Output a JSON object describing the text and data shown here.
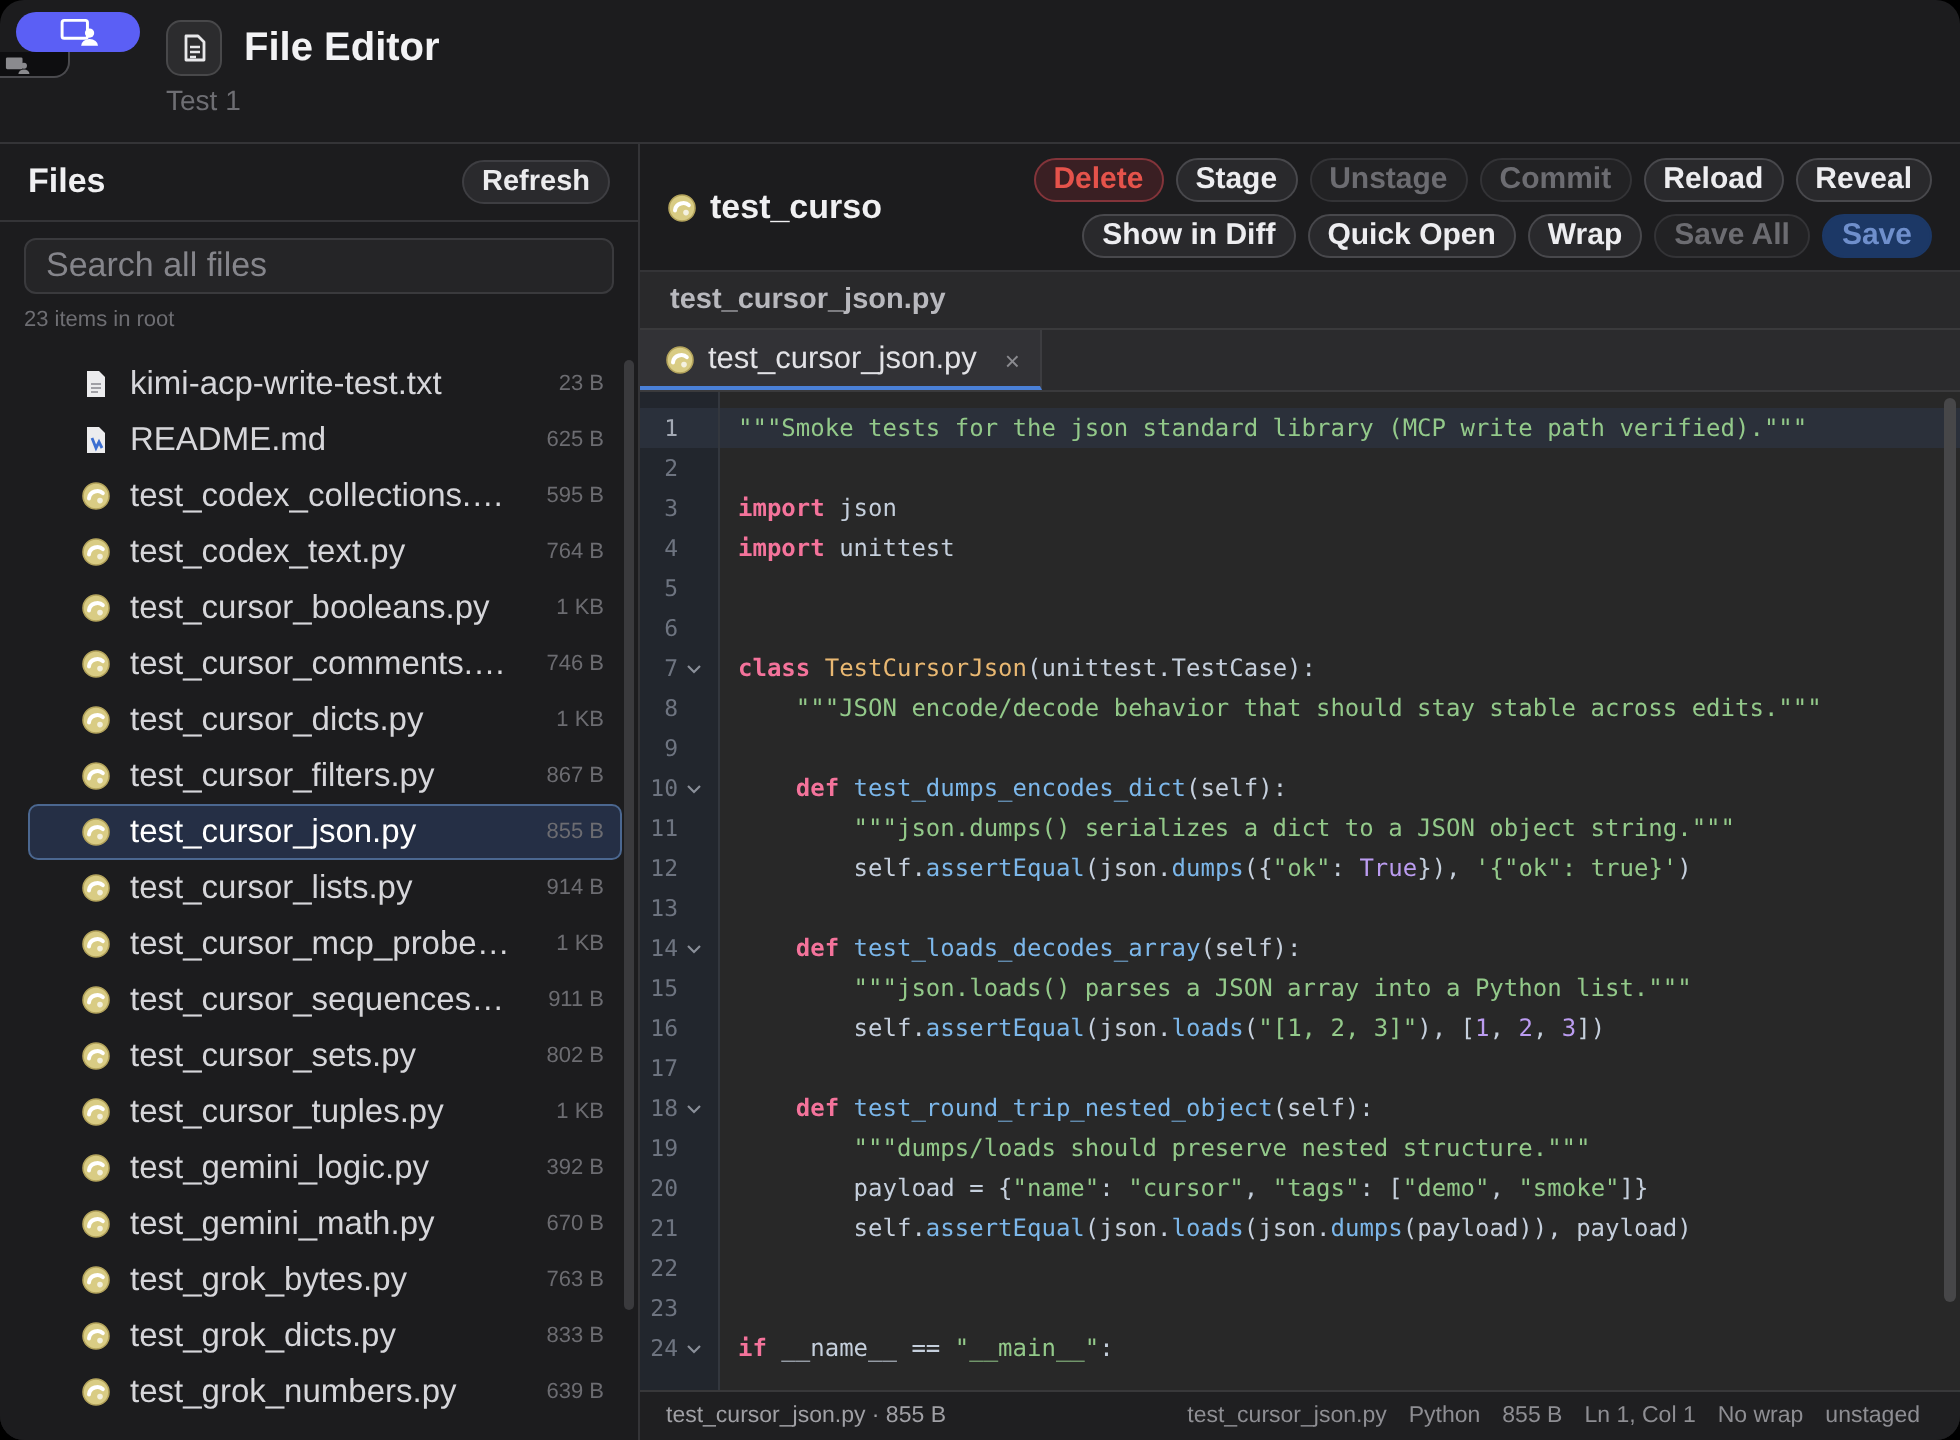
{
  "header": {
    "title": "File Editor",
    "subtitle": "Test 1"
  },
  "sidebar": {
    "title": "Files",
    "refresh_button": "Refresh",
    "search": {
      "placeholder": "Search all files"
    },
    "summary": "23 items in root",
    "files": [
      {
        "name": "kimi-acp-write-test.txt",
        "size": "23 B",
        "kind": "text",
        "selected": false
      },
      {
        "name": "README.md",
        "size": "625 B",
        "kind": "markdown",
        "selected": false
      },
      {
        "name": "test_codex_collections.…",
        "size": "595 B",
        "kind": "python",
        "selected": false
      },
      {
        "name": "test_codex_text.py",
        "size": "764 B",
        "kind": "python",
        "selected": false
      },
      {
        "name": "test_cursor_booleans.py",
        "size": "1 KB",
        "kind": "python",
        "selected": false
      },
      {
        "name": "test_cursor_comments.…",
        "size": "746 B",
        "kind": "python",
        "selected": false
      },
      {
        "name": "test_cursor_dicts.py",
        "size": "1 KB",
        "kind": "python",
        "selected": false
      },
      {
        "name": "test_cursor_filters.py",
        "size": "867 B",
        "kind": "python",
        "selected": false
      },
      {
        "name": "test_cursor_json.py",
        "size": "855 B",
        "kind": "python",
        "selected": true
      },
      {
        "name": "test_cursor_lists.py",
        "size": "914 B",
        "kind": "python",
        "selected": false
      },
      {
        "name": "test_cursor_mcp_probe…",
        "size": "1 KB",
        "kind": "python",
        "selected": false
      },
      {
        "name": "test_cursor_sequences…",
        "size": "911 B",
        "kind": "python",
        "selected": false
      },
      {
        "name": "test_cursor_sets.py",
        "size": "802 B",
        "kind": "python",
        "selected": false
      },
      {
        "name": "test_cursor_tuples.py",
        "size": "1 KB",
        "kind": "python",
        "selected": false
      },
      {
        "name": "test_gemini_logic.py",
        "size": "392 B",
        "kind": "python",
        "selected": false
      },
      {
        "name": "test_gemini_math.py",
        "size": "670 B",
        "kind": "python",
        "selected": false
      },
      {
        "name": "test_grok_bytes.py",
        "size": "763 B",
        "kind": "python",
        "selected": false
      },
      {
        "name": "test_grok_dicts.py",
        "size": "833 B",
        "kind": "python",
        "selected": false
      },
      {
        "name": "test_grok_numbers.py",
        "size": "639 B",
        "kind": "python",
        "selected": false
      }
    ]
  },
  "editor": {
    "file_title": "test_curso",
    "toolbar_rows": [
      {
        "buttons": [
          {
            "label": "Delete",
            "kind": "danger",
            "disabled": false
          },
          {
            "label": "Stage",
            "kind": "normal",
            "disabled": false
          },
          {
            "label": "Unstage",
            "kind": "normal",
            "disabled": true
          },
          {
            "label": "Commit",
            "kind": "normal",
            "disabled": true
          },
          {
            "label": "Reload",
            "kind": "normal",
            "disabled": false
          },
          {
            "label": "Reveal",
            "kind": "normal",
            "disabled": false
          }
        ]
      },
      {
        "buttons": [
          {
            "label": "Show in Diff",
            "kind": "normal",
            "disabled": false
          },
          {
            "label": "Quick Open",
            "kind": "normal",
            "disabled": false
          },
          {
            "label": "Wrap",
            "kind": "normal",
            "disabled": false
          },
          {
            "label": "Save All",
            "kind": "normal",
            "disabled": true
          },
          {
            "label": "Save",
            "kind": "primary",
            "disabled": true
          }
        ]
      }
    ],
    "breadcrumb": "test_cursor_json.py",
    "tabs": [
      {
        "label": "test_cursor_json.py",
        "close": "×",
        "selected": true
      }
    ],
    "lines": [
      {
        "n": "1",
        "current": true,
        "foldable": false,
        "tokens": [
          {
            "kind": "string",
            "text": "\"\"\"Smoke tests for the json standard library (MCP write path verified).\"\"\""
          }
        ]
      },
      {
        "n": "2",
        "current": false,
        "foldable": false
      },
      {
        "n": "3",
        "current": false,
        "foldable": false,
        "tokens": [
          {
            "kind": "keyword",
            "text": "import"
          },
          {
            "kind": "plain",
            "text": " json"
          }
        ]
      },
      {
        "n": "4",
        "current": false,
        "foldable": false,
        "tokens": [
          {
            "kind": "keyword",
            "text": "import"
          },
          {
            "kind": "plain",
            "text": " unittest"
          }
        ]
      },
      {
        "n": "5",
        "current": false,
        "foldable": false
      },
      {
        "n": "6",
        "current": false,
        "foldable": false
      },
      {
        "n": "7",
        "current": false,
        "foldable": true,
        "tokens": [
          {
            "kind": "keyword",
            "text": "class "
          },
          {
            "kind": "class",
            "text": "TestCursorJson"
          },
          {
            "kind": "plain",
            "text": "(unittest.TestCase):"
          }
        ]
      },
      {
        "n": "8",
        "current": false,
        "foldable": false,
        "tokens": [
          {
            "kind": "string",
            "text": "    \"\"\"JSON encode/decode behavior that should stay stable across edits.\"\"\""
          }
        ]
      },
      {
        "n": "9",
        "current": false,
        "foldable": false
      },
      {
        "n": "10",
        "current": false,
        "foldable": true,
        "tokens": [
          {
            "kind": "keyword",
            "text": "    def "
          },
          {
            "kind": "function",
            "text": "test_dumps_encodes_dict"
          },
          {
            "kind": "plain",
            "text": "(self):"
          }
        ]
      },
      {
        "n": "11",
        "current": false,
        "foldable": false,
        "tokens": [
          {
            "kind": "string",
            "text": "        \"\"\"json.dumps() serializes a dict to a JSON object string.\"\"\""
          }
        ]
      },
      {
        "n": "12",
        "current": false,
        "foldable": false,
        "tokens": [
          {
            "kind": "plain",
            "text": "        self."
          },
          {
            "kind": "function",
            "text": "assertEqual"
          },
          {
            "kind": "plain",
            "text": "(json."
          },
          {
            "kind": "function",
            "text": "dumps"
          },
          {
            "kind": "plain",
            "text": "({"
          },
          {
            "kind": "string",
            "text": "\"ok\""
          },
          {
            "kind": "plain",
            "text": ": "
          },
          {
            "kind": "number",
            "text": "True"
          },
          {
            "kind": "plain",
            "text": "}), "
          },
          {
            "kind": "string",
            "text": "'{\"ok\": true}'"
          },
          {
            "kind": "plain",
            "text": ")"
          }
        ]
      },
      {
        "n": "13",
        "current": false,
        "foldable": false
      },
      {
        "n": "14",
        "current": false,
        "foldable": true,
        "tokens": [
          {
            "kind": "keyword",
            "text": "    def "
          },
          {
            "kind": "function",
            "text": "test_loads_decodes_array"
          },
          {
            "kind": "plain",
            "text": "(self):"
          }
        ]
      },
      {
        "n": "15",
        "current": false,
        "foldable": false,
        "tokens": [
          {
            "kind": "string",
            "text": "        \"\"\"json.loads() parses a JSON array into a Python list.\"\"\""
          }
        ]
      },
      {
        "n": "16",
        "current": false,
        "foldable": false,
        "tokens": [
          {
            "kind": "plain",
            "text": "        self."
          },
          {
            "kind": "function",
            "text": "assertEqual"
          },
          {
            "kind": "plain",
            "text": "(json."
          },
          {
            "kind": "function",
            "text": "loads"
          },
          {
            "kind": "plain",
            "text": "("
          },
          {
            "kind": "string",
            "text": "\"[1, 2, 3]\""
          },
          {
            "kind": "plain",
            "text": "), ["
          },
          {
            "kind": "number",
            "text": "1"
          },
          {
            "kind": "plain",
            "text": ", "
          },
          {
            "kind": "number",
            "text": "2"
          },
          {
            "kind": "plain",
            "text": ", "
          },
          {
            "kind": "number",
            "text": "3"
          },
          {
            "kind": "plain",
            "text": "])"
          }
        ]
      },
      {
        "n": "17",
        "current": false,
        "foldable": false
      },
      {
        "n": "18",
        "current": false,
        "foldable": true,
        "tokens": [
          {
            "kind": "keyword",
            "text": "    def "
          },
          {
            "kind": "function",
            "text": "test_round_trip_nested_object"
          },
          {
            "kind": "plain",
            "text": "(self):"
          }
        ]
      },
      {
        "n": "19",
        "current": false,
        "foldable": false,
        "tokens": [
          {
            "kind": "string",
            "text": "        \"\"\"dumps/loads should preserve nested structure.\"\"\""
          }
        ]
      },
      {
        "n": "20",
        "current": false,
        "foldable": false,
        "tokens": [
          {
            "kind": "plain",
            "text": "        payload = {"
          },
          {
            "kind": "string",
            "text": "\"name\""
          },
          {
            "kind": "plain",
            "text": ": "
          },
          {
            "kind": "string",
            "text": "\"cursor\""
          },
          {
            "kind": "plain",
            "text": ", "
          },
          {
            "kind": "string",
            "text": "\"tags\""
          },
          {
            "kind": "plain",
            "text": ": ["
          },
          {
            "kind": "string",
            "text": "\"demo\""
          },
          {
            "kind": "plain",
            "text": ", "
          },
          {
            "kind": "string",
            "text": "\"smoke\""
          },
          {
            "kind": "plain",
            "text": "]}"
          }
        ]
      },
      {
        "n": "21",
        "current": false,
        "foldable": false,
        "tokens": [
          {
            "kind": "plain",
            "text": "        self."
          },
          {
            "kind": "function",
            "text": "assertEqual"
          },
          {
            "kind": "plain",
            "text": "(json."
          },
          {
            "kind": "function",
            "text": "loads"
          },
          {
            "kind": "plain",
            "text": "(json."
          },
          {
            "kind": "function",
            "text": "dumps"
          },
          {
            "kind": "plain",
            "text": "(payload)), payload)"
          }
        ]
      },
      {
        "n": "22",
        "current": false,
        "foldable": false
      },
      {
        "n": "23",
        "current": false,
        "foldable": false
      },
      {
        "n": "24",
        "current": false,
        "foldable": true,
        "tokens": [
          {
            "kind": "keyword",
            "text": "if"
          },
          {
            "kind": "plain",
            "text": " __name__ == "
          },
          {
            "kind": "string",
            "text": "\"__main__\""
          },
          {
            "kind": "plain",
            "text": ":"
          }
        ]
      }
    ]
  },
  "status_bar": {
    "left": "test_cursor_json.py · 855 B",
    "items": [
      "test_cursor_json.py",
      "Python",
      "855 B",
      "Ln 1, Col 1",
      "No wrap",
      "unstaged"
    ]
  }
}
